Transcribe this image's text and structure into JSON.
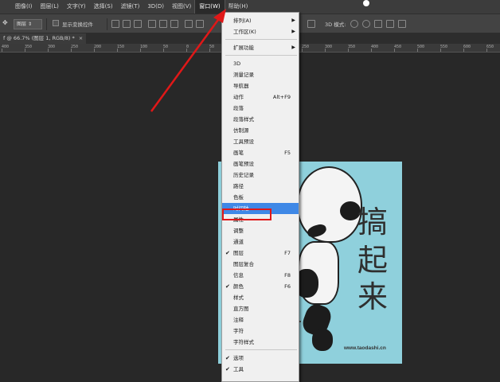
{
  "menubar": {
    "items": [
      {
        "label": "图像(I)"
      },
      {
        "label": "图层(L)"
      },
      {
        "label": "文字(Y)"
      },
      {
        "label": "选择(S)"
      },
      {
        "label": "滤镜(T)"
      },
      {
        "label": "3D(D)"
      },
      {
        "label": "视图(V)"
      },
      {
        "label": "窗口(W)"
      },
      {
        "label": "帮助(H)"
      }
    ]
  },
  "options_bar": {
    "dropdown_value": "图层",
    "checkbox_label": "显示变换控件",
    "mode_label": "3D 模式:"
  },
  "document_tab": {
    "title": "f @ 66.7% (图层 1, RGB/8) *",
    "close": "×"
  },
  "ruler": {
    "ticks": [
      "400",
      "350",
      "300",
      "250",
      "200",
      "150",
      "100",
      "50",
      "0",
      "50",
      "100",
      "150",
      "200",
      "250",
      "300",
      "350",
      "400",
      "450",
      "500",
      "550",
      "600",
      "650"
    ]
  },
  "image": {
    "caption_chars": [
      "搞",
      "起",
      "来"
    ],
    "site": "www.taodashi.cn"
  },
  "window_menu": {
    "items": [
      {
        "label": "排列(A)",
        "submenu": true
      },
      {
        "label": "工作区(K)",
        "submenu": true
      },
      {
        "sep": true
      },
      {
        "label": "扩展功能",
        "submenu": true
      },
      {
        "sep": true
      },
      {
        "label": "3D"
      },
      {
        "label": "测量记录"
      },
      {
        "label": "导航器"
      },
      {
        "label": "动作",
        "shortcut": "Alt+F9"
      },
      {
        "label": "段落"
      },
      {
        "label": "段落样式"
      },
      {
        "label": "仿制源"
      },
      {
        "label": "工具预设"
      },
      {
        "label": "画笔",
        "shortcut": "F5"
      },
      {
        "label": "画笔预设"
      },
      {
        "label": "历史记录"
      },
      {
        "label": "路径"
      },
      {
        "label": "色板"
      },
      {
        "label": "时间轴",
        "selected": true
      },
      {
        "label": "属性"
      },
      {
        "label": "调整"
      },
      {
        "label": "通道"
      },
      {
        "label": "图层",
        "shortcut": "F7",
        "checked": true
      },
      {
        "label": "图层复合"
      },
      {
        "label": "信息",
        "shortcut": "F8"
      },
      {
        "label": "颜色",
        "shortcut": "F6",
        "checked": true
      },
      {
        "label": "样式"
      },
      {
        "label": "直方图"
      },
      {
        "label": "注释"
      },
      {
        "label": "字符"
      },
      {
        "label": "字符样式"
      },
      {
        "sep": true
      },
      {
        "label": "选项",
        "checked": true
      },
      {
        "label": "工具",
        "checked": true
      }
    ]
  },
  "colors": {
    "menu_highlight": "#3f88e6",
    "annotation_red": "#e01818",
    "image_bg": "#8fd0dc"
  }
}
